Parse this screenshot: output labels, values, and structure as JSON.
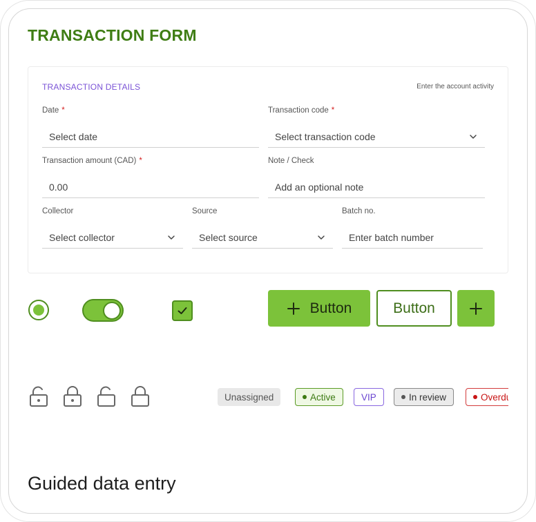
{
  "page": {
    "title": "TRANSACTION FORM",
    "footer_title": "Guided data entry"
  },
  "card": {
    "title": "TRANSACTION DETAILS",
    "hint": "Enter the account activity",
    "fields": {
      "date": {
        "label": "Date",
        "required_mark": "*",
        "placeholder": "Select date"
      },
      "transaction_code": {
        "label": "Transaction code",
        "required_mark": "*",
        "placeholder": "Select transaction code"
      },
      "amount": {
        "label": "Transaction amount (CAD)",
        "required_mark": "*",
        "value": "0.00"
      },
      "note": {
        "label": "Note / Check",
        "placeholder": "Add an optional note"
      },
      "collector": {
        "label": "Collector",
        "placeholder": "Select collector"
      },
      "source": {
        "label": "Source",
        "placeholder": "Select source"
      },
      "batch": {
        "label": "Batch no.",
        "placeholder": "Enter batch number"
      }
    }
  },
  "controls": {
    "radio_selected": true,
    "toggle_on": true,
    "checkbox_checked": true,
    "primary_button": {
      "icon": "plus-icon",
      "label": "Button"
    },
    "outline_button": {
      "label": "Button"
    },
    "icon_button": {
      "icon": "plus-icon",
      "label": "+"
    }
  },
  "locks": [
    "lock-open-icon",
    "lock-closed-icon",
    "lock-open-icon",
    "lock-closed-icon"
  ],
  "tags": {
    "unassigned": "Unassigned",
    "active": "Active",
    "vip": "VIP",
    "review": "In review",
    "overdue": "Overdue"
  },
  "colors": {
    "brand_green": "#7cc23a",
    "brand_green_dark": "#4f8e1f",
    "title_green": "#3f7d14",
    "accent_purple": "#7a52d6",
    "required_red": "#d42020"
  }
}
